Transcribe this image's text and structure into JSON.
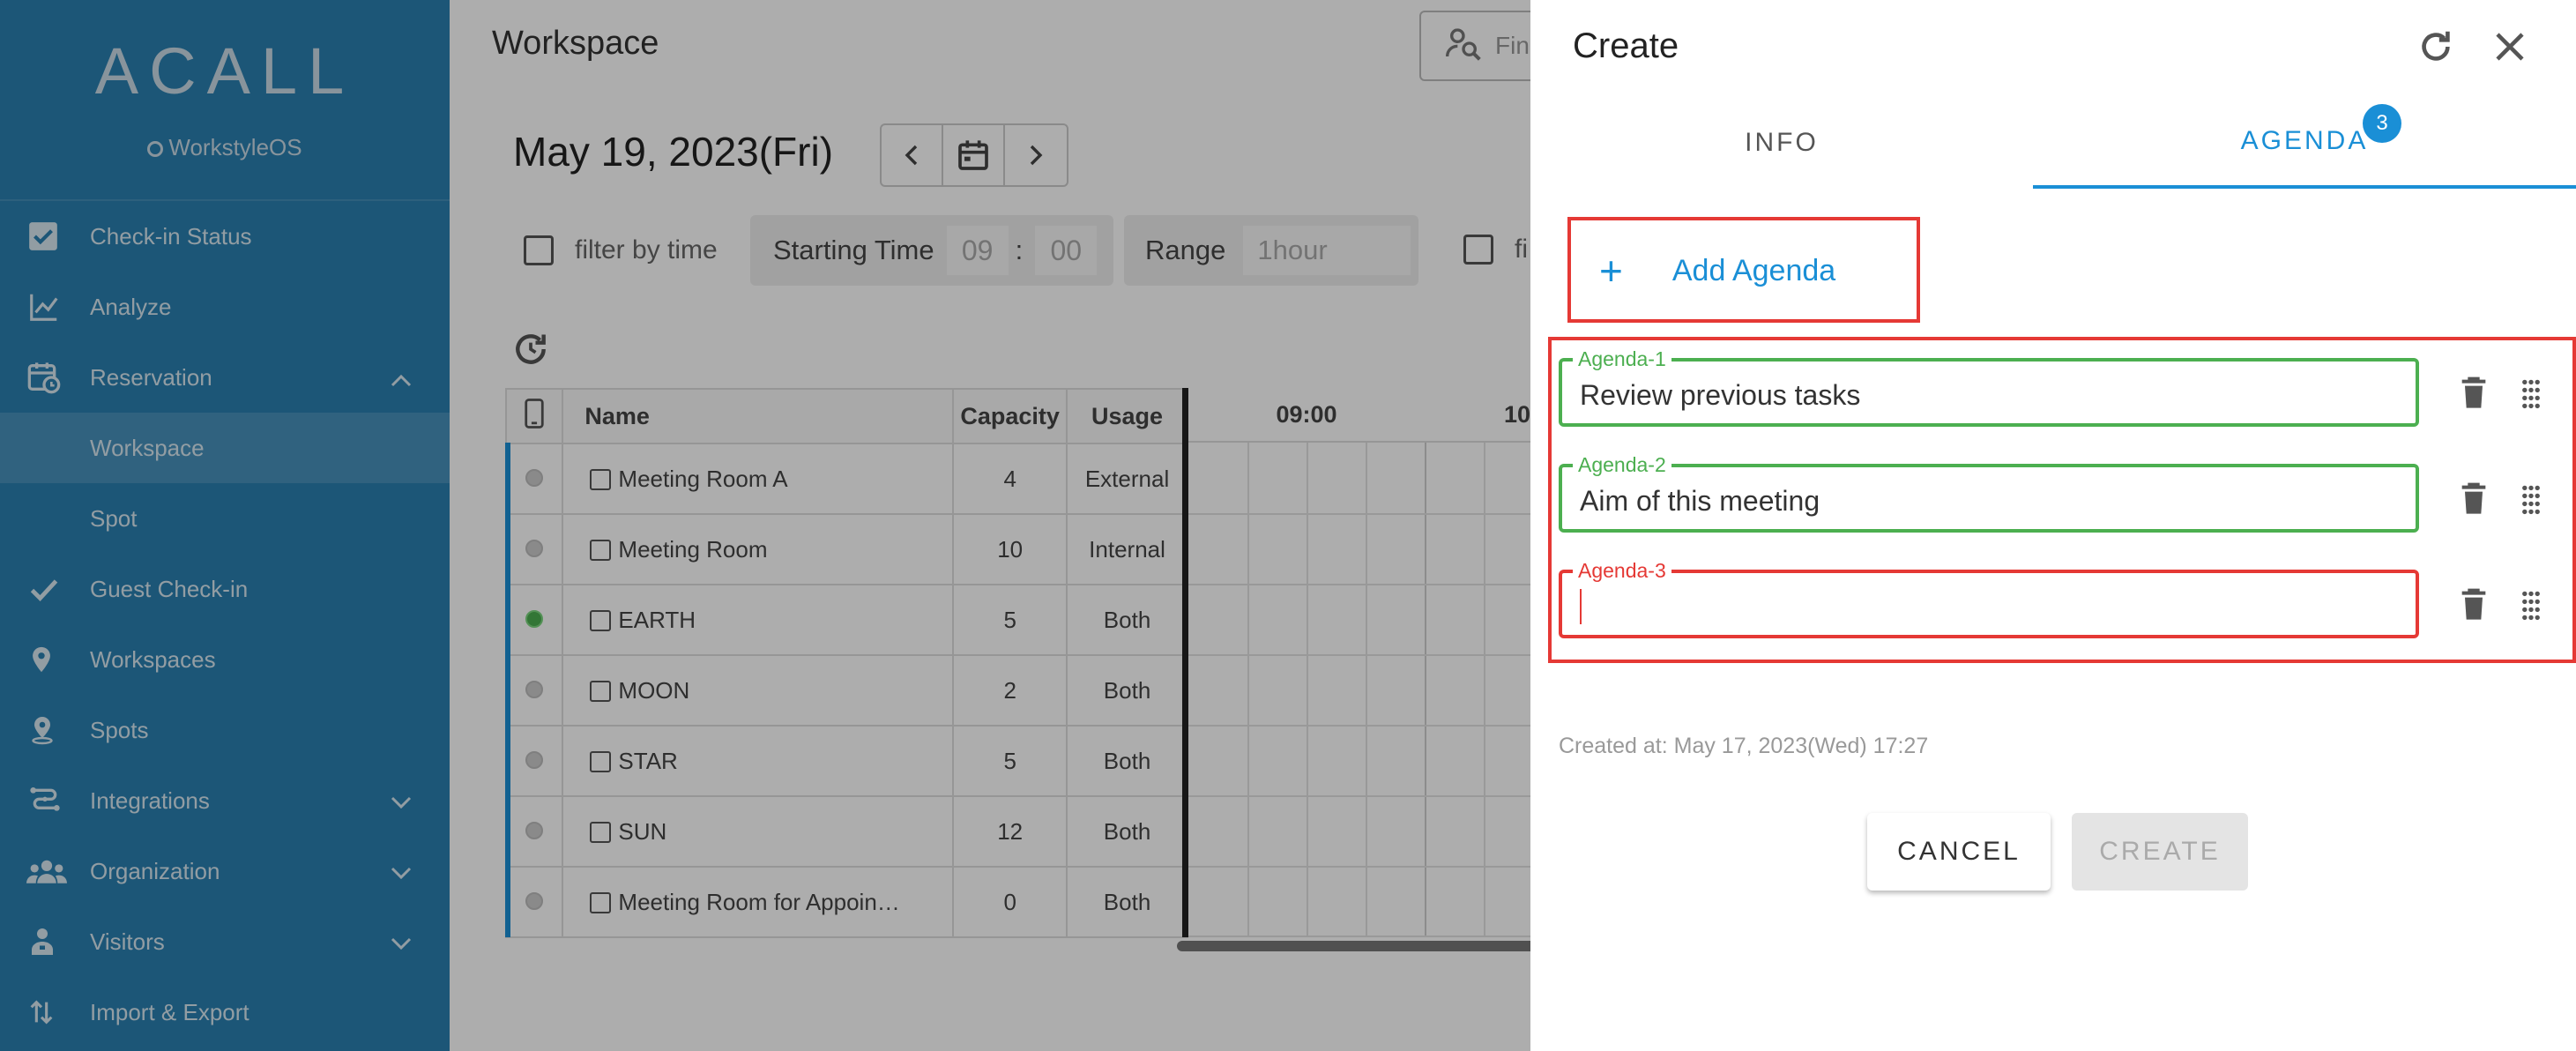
{
  "sidebar": {
    "logo": "ACALL",
    "logo_sub": "WorkstyleOS",
    "items": [
      {
        "label": "Check-in Status",
        "icon": "checkbox-icon"
      },
      {
        "label": "Analyze",
        "icon": "chart-line-icon"
      },
      {
        "label": "Reservation",
        "icon": "calendar-clock-icon",
        "expanded": true
      },
      {
        "label": "Workspace",
        "sub": true,
        "active": true
      },
      {
        "label": "Spot",
        "sub": true
      },
      {
        "label": "Guest Check-in",
        "icon": "check-icon"
      },
      {
        "label": "Workspaces",
        "icon": "location-pin-icon"
      },
      {
        "label": "Spots",
        "icon": "location-pin-outline-icon"
      },
      {
        "label": "Integrations",
        "icon": "integrations-icon",
        "collapsed": true
      },
      {
        "label": "Organization",
        "icon": "people-icon",
        "collapsed": true
      },
      {
        "label": "Visitors",
        "icon": "visitor-icon",
        "collapsed": true
      },
      {
        "label": "Import & Export",
        "icon": "import-export-icon"
      }
    ]
  },
  "main": {
    "title": "Workspace",
    "find_placeholder": "Fin",
    "date": "May 19, 2023(Fri)",
    "filter_by_time_label": "filter by time",
    "starting_time_label": "Starting Time",
    "start_hour": "09",
    "start_minute": "00",
    "time_separator": ":",
    "range_label": "Range",
    "range_value": "1hour",
    "filter2_label": "fi",
    "table": {
      "headers": [
        "Name",
        "Capacity",
        "Usage"
      ],
      "timeline_headers": [
        "09:00",
        "10"
      ],
      "rows": [
        {
          "name": "Meeting Room A",
          "capacity": "4",
          "usage": "External",
          "status": "grey"
        },
        {
          "name": "Meeting Room",
          "capacity": "10",
          "usage": "Internal",
          "status": "grey"
        },
        {
          "name": "EARTH",
          "capacity": "5",
          "usage": "Both",
          "status": "green"
        },
        {
          "name": "MOON",
          "capacity": "2",
          "usage": "Both",
          "status": "grey"
        },
        {
          "name": "STAR",
          "capacity": "5",
          "usage": "Both",
          "status": "grey"
        },
        {
          "name": "SUN",
          "capacity": "12",
          "usage": "Both",
          "status": "grey"
        },
        {
          "name": "Meeting Room for Appoin…",
          "capacity": "0",
          "usage": "Both",
          "status": "grey"
        }
      ]
    }
  },
  "dialog": {
    "title": "Create",
    "tabs": [
      {
        "label": "INFO",
        "active": false
      },
      {
        "label": "AGENDA",
        "active": true
      }
    ],
    "agenda_badge": "3",
    "add_agenda_label": "Add Agenda",
    "agendas": [
      {
        "label": "Agenda-1",
        "value": "Review previous tasks",
        "state": "valid"
      },
      {
        "label": "Agenda-2",
        "value": "Aim of this meeting",
        "state": "valid"
      },
      {
        "label": "Agenda-3",
        "value": "",
        "state": "error"
      }
    ],
    "created_at": "Created at: May 17, 2023(Wed) 17:27",
    "cancel_label": "CANCEL",
    "create_label": "CREATE"
  },
  "colors": {
    "sidebar_bg": "#2a7fb0",
    "accent": "#1a8fd6",
    "valid": "#4caf50",
    "error": "#e53935"
  }
}
